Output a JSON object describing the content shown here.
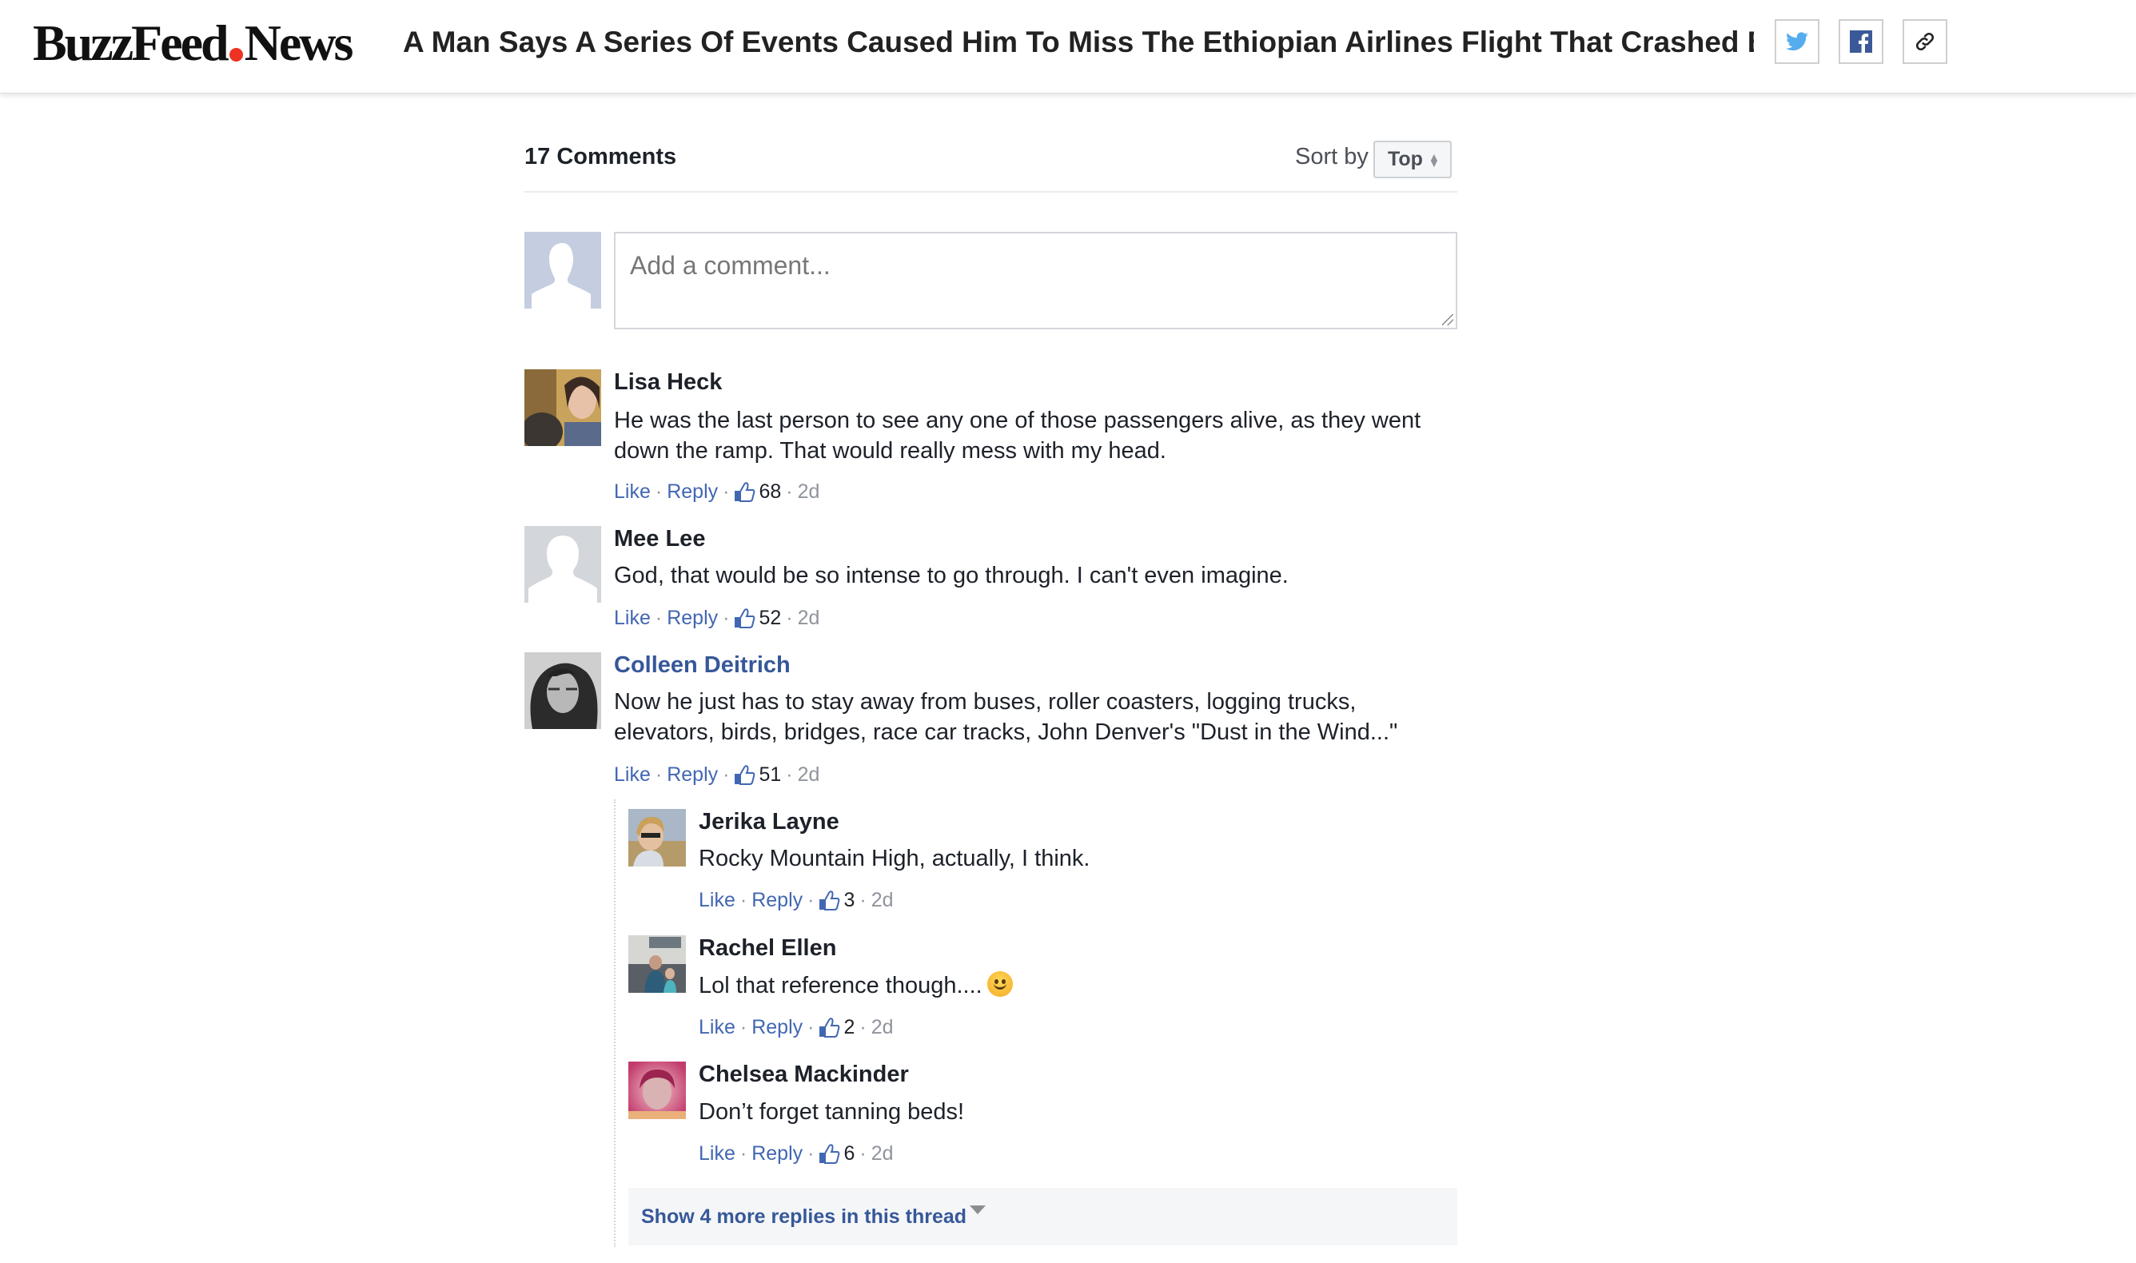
{
  "header": {
    "logo_main": "BuzzFeed",
    "logo_sub": "News",
    "title": "A Man Says A Series Of Events Caused Him To Miss The Ethiopian Airlines Flight That Crashed By ...",
    "share": [
      {
        "icon": "twitter-icon",
        "color": "#55acee"
      },
      {
        "icon": "facebook-icon",
        "color": "#3b5998"
      },
      {
        "icon": "link-icon",
        "color": "#222222"
      }
    ]
  },
  "comments_header": {
    "count_label": "17 Comments",
    "sort_label": "Sort by",
    "sort_value": "Top"
  },
  "composer": {
    "placeholder": "Add a comment..."
  },
  "actions": {
    "like": "Like",
    "reply": "Reply",
    "dot": "·"
  },
  "comments": [
    {
      "name": "Lisa Heck",
      "name_is_link": false,
      "text": "He was the last person to see any one of those passengers alive, as they went down the ramp. That would really mess with my head.",
      "likes": "68",
      "time": "2d"
    },
    {
      "name": "Mee Lee",
      "name_is_link": false,
      "text": "God, that would be so intense to go through. I can't even imagine.",
      "likes": "52",
      "time": "2d"
    },
    {
      "name": "Colleen Deitrich",
      "name_is_link": true,
      "text": "Now he just has to stay away from buses, roller coasters, logging trucks, elevators, birds, bridges, race car tracks, John Denver's \"Dust in the Wind...\"",
      "likes": "51",
      "time": "2d"
    }
  ],
  "replies": [
    {
      "name": "Jerika Layne",
      "text": "Rocky Mountain High, actually, I think.",
      "likes": "3",
      "time": "2d"
    },
    {
      "name": "Rachel Ellen",
      "text": "Lol that reference though....",
      "emoji": "slightly-smiling-face",
      "likes": "2",
      "time": "2d"
    },
    {
      "name": "Chelsea Mackinder",
      "text": "Don’t forget tanning beds!",
      "likes": "6",
      "time": "2d"
    }
  ],
  "show_more": {
    "label": "Show 4 more replies in this thread"
  },
  "colors": {
    "link": "#4267b2",
    "name_link": "#365899",
    "muted": "#90949c",
    "logo_dot": "#e32e22"
  }
}
